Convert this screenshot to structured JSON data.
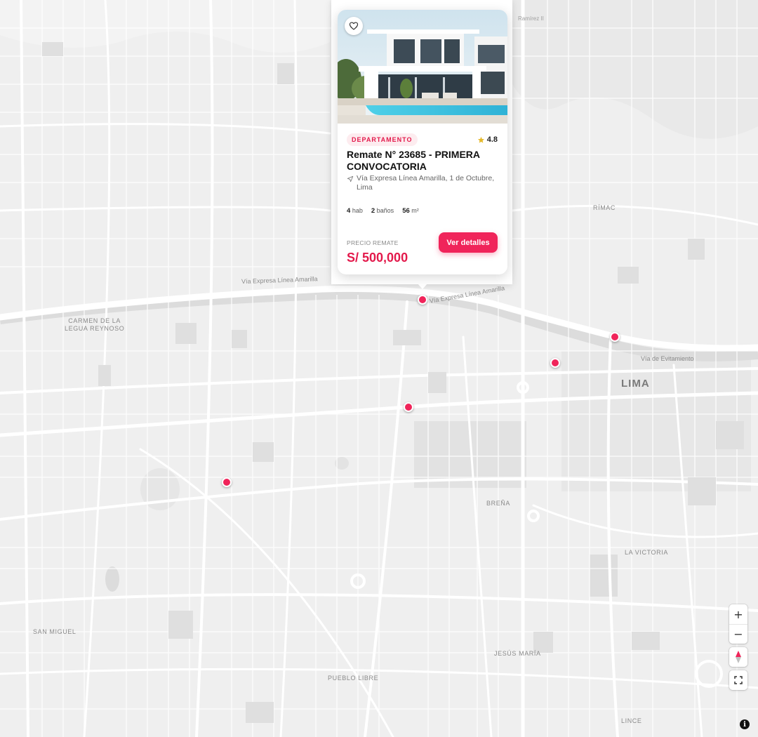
{
  "map": {
    "district_labels": [
      {
        "id": "carmen",
        "text": "CARMEN DE LA\nLEGUA REYNOSO"
      },
      {
        "id": "rimac",
        "text": "RÍMAC"
      },
      {
        "id": "lima",
        "text": "LIMA"
      },
      {
        "id": "brena",
        "text": "BREÑA"
      },
      {
        "id": "victoria",
        "text": "LA VICTORIA"
      },
      {
        "id": "sanmiguel",
        "text": "SAN MIGUEL"
      },
      {
        "id": "jesusmaria",
        "text": "JESÚS MARÍA"
      },
      {
        "id": "pueblolibre",
        "text": "PUEBLO LIBRE"
      },
      {
        "id": "lince",
        "text": "LINCE"
      }
    ],
    "road_labels": [
      {
        "id": "vel-1",
        "text": "Vía Expresa Línea Amarilla"
      },
      {
        "id": "vel-2",
        "text": "Vía Expresa Línea Amarilla"
      },
      {
        "id": "evitamiento",
        "text": "Vía de Evitamiento"
      }
    ],
    "corner_text": "Ramírez II",
    "marker_color": "#f0245a"
  },
  "popup": {
    "favorite_icon": "heart-outline-icon",
    "badge": "DEPARTAMENTO",
    "rating": "4.8",
    "rating_icon": "star-icon",
    "title": "Remate N° 23685 - PRIMERA CONVOCATORIA",
    "address": "Vía Expresa Línea Amarilla, 1 de Octubre, Lima",
    "address_icon": "navigation-arrow-icon",
    "specs": {
      "rooms_value": "4",
      "rooms_unit": "hab",
      "baths_value": "2",
      "baths_unit": "baños",
      "area_value": "56",
      "area_unit": "m²"
    },
    "price_label": "PRECIO REMATE",
    "price": "S/ 500,000",
    "cta_label": "Ver detalles",
    "accent_color": "#e3194b"
  },
  "controls": {
    "zoom_in": "+",
    "zoom_out": "−",
    "compass_icon": "compass-icon",
    "fullscreen_icon": "fullscreen-icon",
    "info": "i"
  }
}
